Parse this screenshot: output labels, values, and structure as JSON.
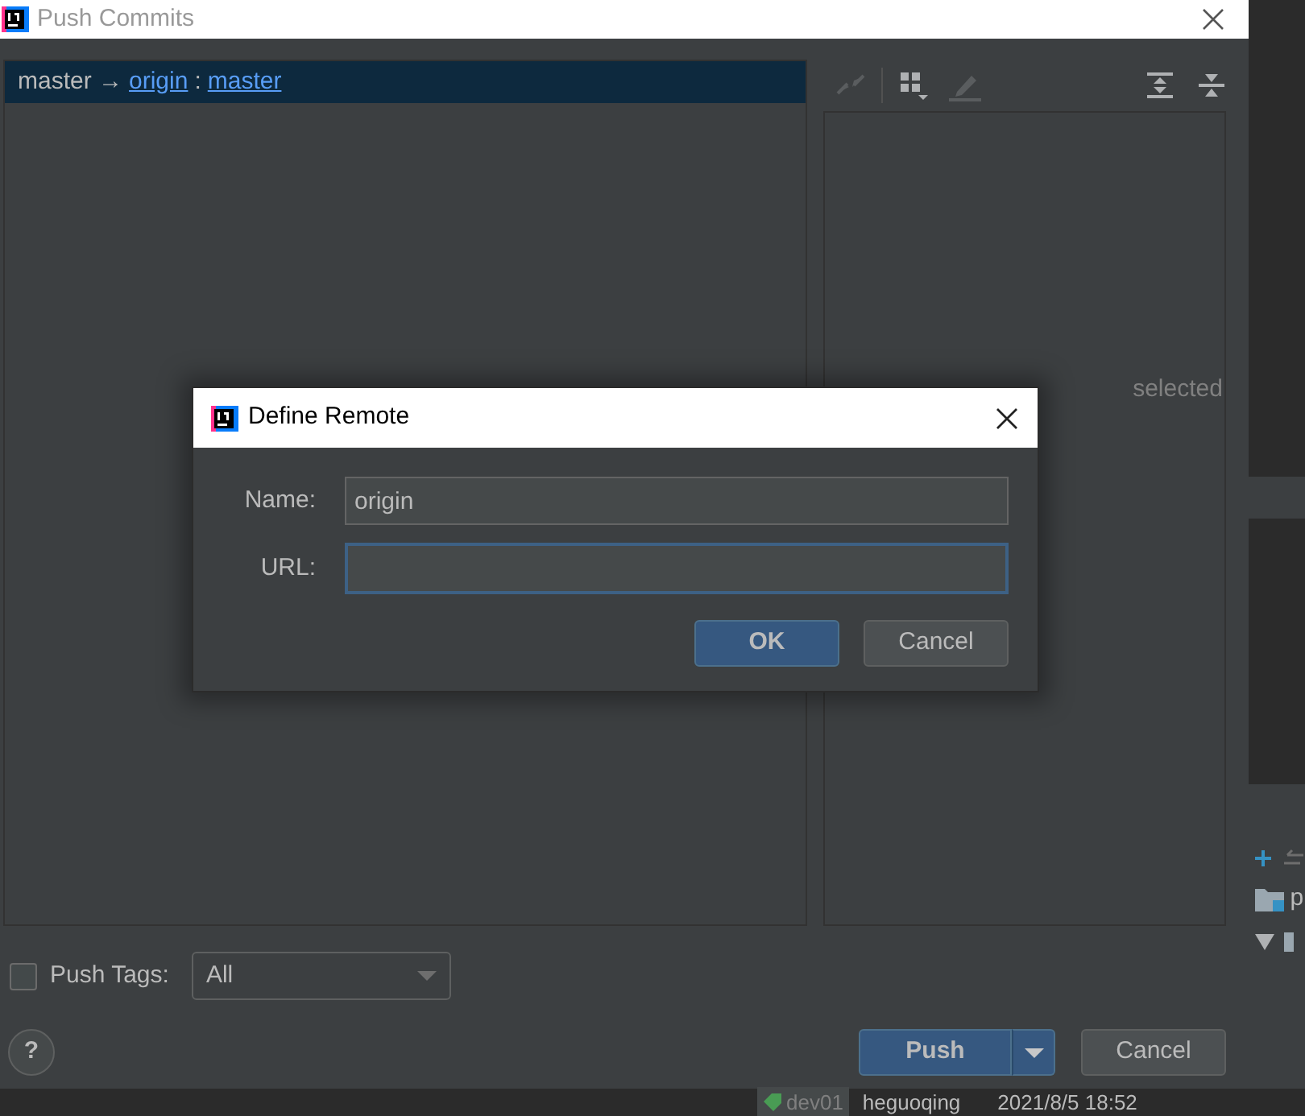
{
  "window": {
    "title": "Push Commits"
  },
  "branch_row": {
    "source": "master",
    "arrow": "→",
    "remote": "origin",
    "separator": ":",
    "target": "master",
    "selected": true
  },
  "toolbar": [
    {
      "kind": "merge",
      "disabled": true
    },
    {
      "kind": "grid",
      "disabled": false
    },
    {
      "kind": "edit",
      "disabled": true
    },
    {
      "kind": "expand",
      "disabled": false
    },
    {
      "kind": "collapse",
      "disabled": false
    }
  ],
  "details": {
    "empty_text": "selected"
  },
  "push_tags": {
    "label": "Push Tags:",
    "checked": false,
    "value": "All"
  },
  "help": "?",
  "buttons": [
    {
      "label": "Push",
      "kind": "split",
      "default": true
    },
    {
      "label": "Cancel",
      "kind": "plain",
      "default": false
    }
  ],
  "dialog": {
    "title": "Define Remote",
    "fields": [
      {
        "label": "Name:",
        "value": "origin",
        "focused": false
      },
      {
        "label": "URL:",
        "focused": true
      }
    ],
    "buttons": [
      {
        "label": "OK",
        "default": true
      },
      {
        "label": "Cancel",
        "default": false
      }
    ]
  },
  "background": {
    "tree_label": "p",
    "log_row": {
      "tag": "dev01",
      "author": "heguoqing",
      "date": "2021/8/5 18:52"
    }
  }
}
